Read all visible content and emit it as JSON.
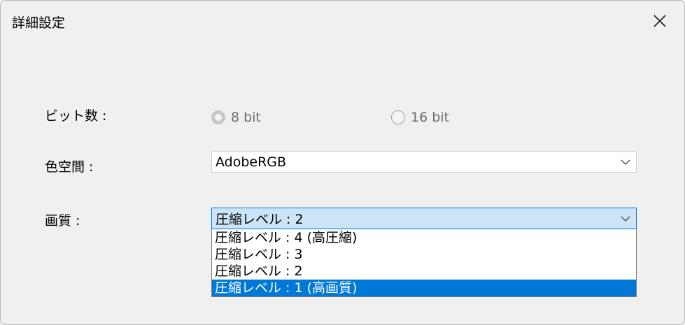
{
  "dialog": {
    "title": "詳細設定"
  },
  "bit_depth": {
    "label": "ビット数 :",
    "options": [
      {
        "label": "8 bit",
        "checked": true
      },
      {
        "label": "16 bit",
        "checked": false
      }
    ]
  },
  "color_space": {
    "label": "色空間 :",
    "value": "AdobeRGB"
  },
  "quality": {
    "label": "画質 :",
    "value": "圧縮レベル : 2",
    "options": [
      "圧縮レベル : 4 (高圧縮)",
      "圧縮レベル : 3",
      "圧縮レベル : 2",
      "圧縮レベル : 1 (高画質)"
    ],
    "highlighted_index": 3
  },
  "icons": {
    "close": "close-icon",
    "chevron": "chevron-down-icon"
  },
  "colors": {
    "highlight": "#0078d7",
    "focused_field": "#cce4f7",
    "dialog_bg": "#f0f0f0"
  }
}
